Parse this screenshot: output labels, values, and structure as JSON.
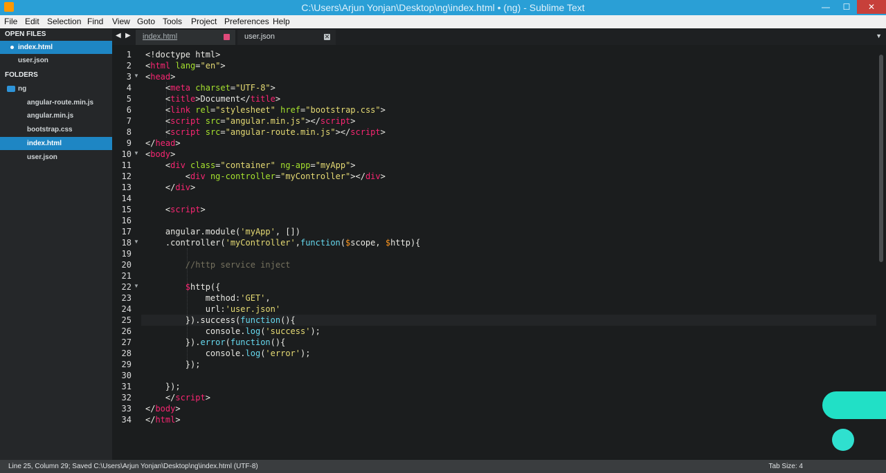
{
  "window": {
    "title": "C:\\Users\\Arjun Yonjan\\Desktop\\ng\\index.html • (ng) - Sublime Text",
    "controls": {
      "minimize": "—",
      "maximize": "☐",
      "close": "✕"
    }
  },
  "menu": [
    "File",
    "Edit",
    "Selection",
    "Find",
    "View",
    "Goto",
    "Tools",
    "Project",
    "Preferences",
    "Help"
  ],
  "sidebar": {
    "open_files_header": "OPEN FILES",
    "open_files": [
      "index.html",
      "user.json"
    ],
    "folders_header": "FOLDERS",
    "folder_name": "ng",
    "folder_files": [
      "angular-route.min.js",
      "angular.min.js",
      "bootstrap.css",
      "index.html",
      "user.json"
    ],
    "selected_open_file": "index.html",
    "selected_folder_file": "index.html"
  },
  "tabs": [
    {
      "label": "index.html",
      "active": true,
      "dirty": true
    },
    {
      "label": "user.json",
      "active": false,
      "dirty": false
    }
  ],
  "editor": {
    "line_numbers": [
      "1",
      "2",
      "3",
      "4",
      "5",
      "6",
      "7",
      "8",
      "9",
      "10",
      "11",
      "12",
      "13",
      "14",
      "15",
      "16",
      "17",
      "18",
      "19",
      "20",
      "21",
      "22",
      "23",
      "24",
      "25",
      "26",
      "27",
      "28",
      "29",
      "30",
      "31",
      "32",
      "33",
      "34"
    ],
    "fold_markers_at": [
      3,
      10,
      18,
      22
    ],
    "current_line": 25
  },
  "status": {
    "left": "Line 25, Column 29; Saved C:\\Users\\Arjun Yonjan\\Desktop\\ng\\index.html (UTF-8)",
    "right": "Tab Size: 4"
  },
  "colors": {
    "titlebar": "#2a9fd6",
    "sidebar_selection": "#1e86c4",
    "editor_bg": "#1b1d1e",
    "tag": "#f92672",
    "attribute": "#a6e22e",
    "string": "#e6db74",
    "keyword": "#66d9ef",
    "comment": "#75715e"
  }
}
